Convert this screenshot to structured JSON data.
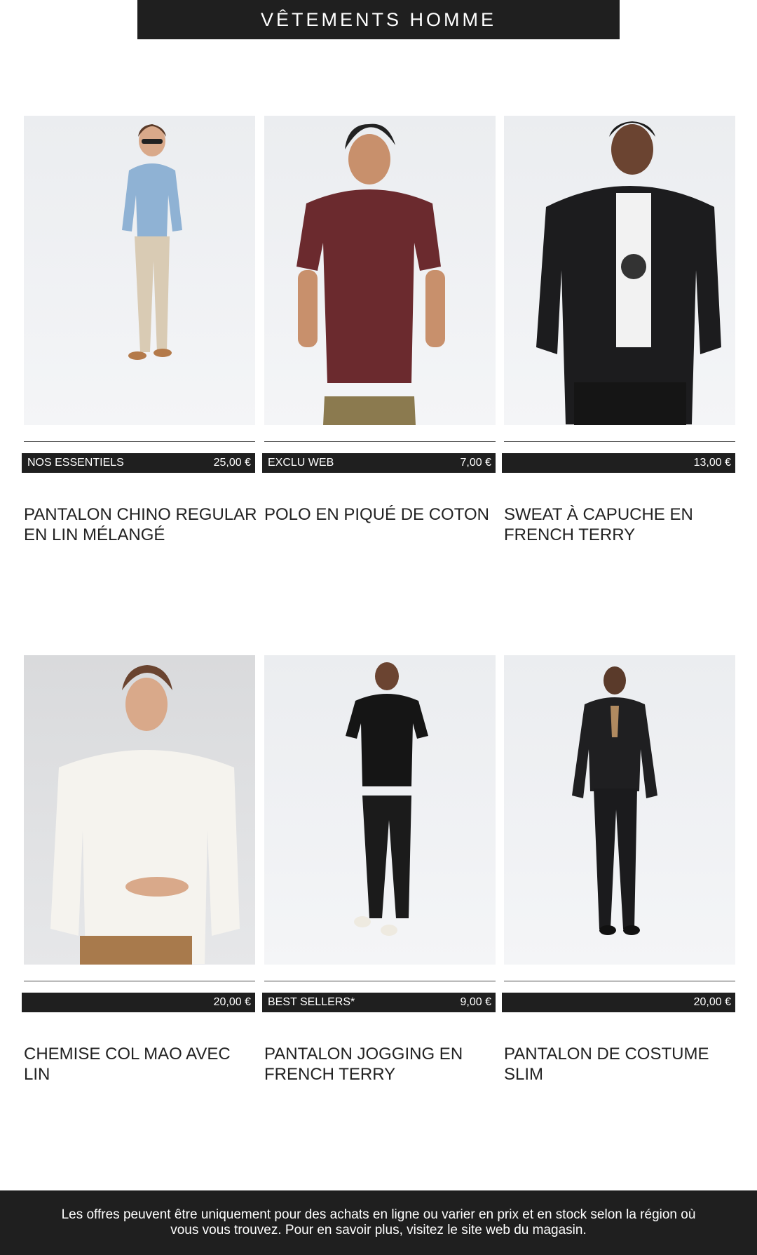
{
  "header": {
    "title": "VÊTEMENTS HOMME"
  },
  "products": [
    {
      "tag": "NOS ESSENTIELS",
      "price": "25,00 €",
      "title": "PANTALON CHINO REGULAR EN LIN MÉLANGÉ",
      "image": "man-blue-shirt-beige-chino"
    },
    {
      "tag": "EXCLU WEB",
      "price": "7,00 €",
      "title": "POLO EN PIQUÉ DE COTON",
      "image": "man-burgundy-polo"
    },
    {
      "tag": "",
      "price": "13,00 €",
      "title": "SWEAT À CAPUCHE EN FRENCH TERRY",
      "image": "man-black-hoodie"
    },
    {
      "tag": "",
      "price": "20,00 €",
      "title": "CHEMISE COL MAO AVEC LIN",
      "image": "man-white-shirt"
    },
    {
      "tag": "BEST SELLERS*",
      "price": "9,00 €",
      "title": "PANTALON JOGGING EN FRENCH TERRY",
      "image": "man-black-jogging"
    },
    {
      "tag": "",
      "price": "20,00 €",
      "title": "PANTALON DE COSTUME SLIM",
      "image": "man-black-suit"
    }
  ],
  "footer": {
    "text": "Les offres peuvent être uniquement pour des achats en ligne ou varier en prix et en stock selon la région où vous vous trouvez. Pour en savoir plus, visitez le site web du magasin."
  },
  "colors": {
    "bar": "#1f1f1f",
    "text": "#222222",
    "background": "#ffffff"
  }
}
